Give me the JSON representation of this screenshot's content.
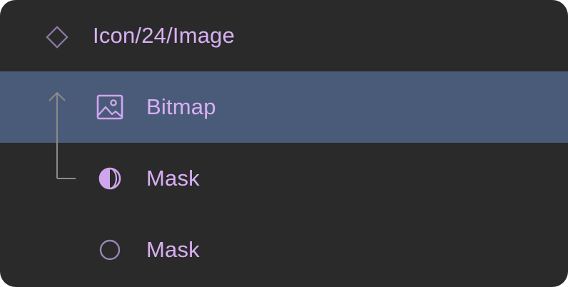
{
  "layers": {
    "group": {
      "label": "Icon/24/Image",
      "icon": "symbol-diamond-icon"
    },
    "items": [
      {
        "label": "Bitmap",
        "icon": "image-icon",
        "selected": true,
        "masked": true
      },
      {
        "label": "Mask",
        "icon": "mask-half-circle-icon",
        "selected": false,
        "is_mask": true
      },
      {
        "label": "Mask",
        "icon": "oval-icon",
        "selected": false
      }
    ]
  },
  "colors": {
    "panel_background": "#2a2a2a",
    "selected_row": "#4a5b79",
    "label_text": "#d8b0f4",
    "icon_stroke": "#9a86b4",
    "mask_indicator": "#8a8a8a"
  }
}
